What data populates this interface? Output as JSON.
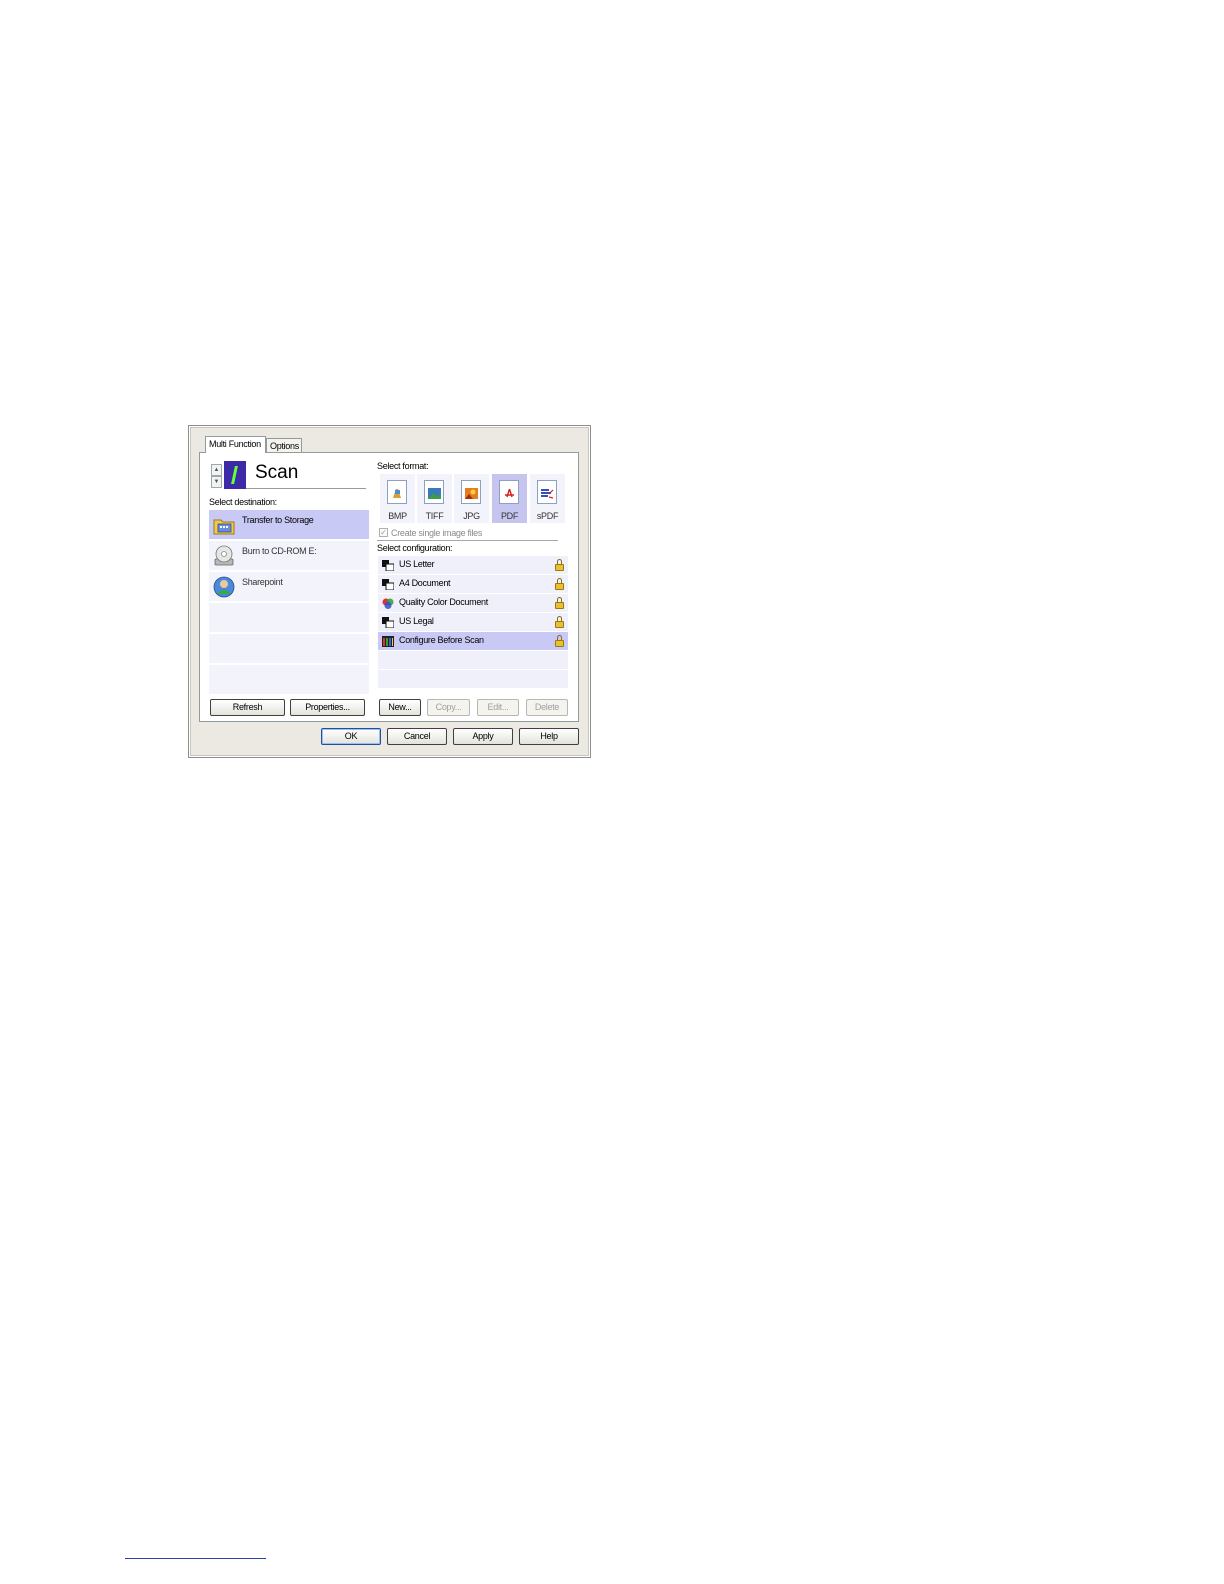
{
  "tabs": [
    {
      "label": "Multi Function",
      "active": true
    },
    {
      "label": "Options",
      "active": false
    }
  ],
  "header": {
    "title": "Scan",
    "spinner_up": "▲",
    "spinner_down": "▼",
    "scan_icon": "scan-button-icon"
  },
  "destination": {
    "label": "Select destination:",
    "items": [
      {
        "label": "Transfer to Storage",
        "icon": "folder-storage-icon",
        "selected": true
      },
      {
        "label": "Burn to CD-ROM  E:",
        "icon": "cd-burn-icon",
        "selected": false
      },
      {
        "label": "Sharepoint",
        "icon": "sharepoint-icon",
        "selected": false
      }
    ],
    "refresh_button": "Refresh",
    "properties_button": "Properties..."
  },
  "format": {
    "label": "Select format:",
    "items": [
      {
        "label": "BMP",
        "icon": "bmp-icon",
        "selected": false
      },
      {
        "label": "TIFF",
        "icon": "tiff-icon",
        "selected": false
      },
      {
        "label": "JPG",
        "icon": "jpg-icon",
        "selected": false
      },
      {
        "label": "PDF",
        "icon": "pdf-icon",
        "selected": true
      },
      {
        "label": "sPDF",
        "icon": "spdf-icon",
        "selected": false
      }
    ],
    "single_image_checkbox": {
      "label": "Create single image files",
      "checked": true,
      "enabled": false
    }
  },
  "configuration": {
    "label": "Select configuration:",
    "items": [
      {
        "label": "US Letter",
        "icon": "bw-document-icon",
        "locked": true,
        "selected": false
      },
      {
        "label": "A4 Document",
        "icon": "bw-document-icon",
        "locked": true,
        "selected": false
      },
      {
        "label": "Quality Color Document",
        "icon": "color-document-icon",
        "locked": true,
        "selected": false
      },
      {
        "label": "US Legal",
        "icon": "bw-document-icon",
        "locked": true,
        "selected": false
      },
      {
        "label": "Configure Before Scan",
        "icon": "configure-icon",
        "locked": true,
        "selected": true
      }
    ],
    "new_button": "New...",
    "copy_button": "Copy...",
    "edit_button": "Edit...",
    "delete_button": "Delete"
  },
  "footer": {
    "ok_button": "OK",
    "cancel_button": "Cancel",
    "apply_button": "Apply",
    "help_button": "Help"
  },
  "colors": {
    "selection": "#c9c9f5",
    "row_background": "#f3f3fc",
    "dialog_background": "#ece9e2"
  }
}
